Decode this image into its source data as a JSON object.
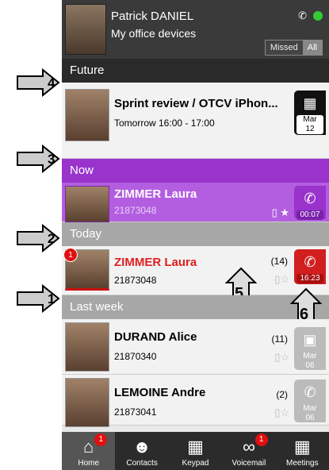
{
  "header": {
    "user_name": "Patrick DANIEL",
    "subtitle": "My office devices",
    "filter": {
      "missed": "Missed",
      "all": "All"
    }
  },
  "sections": {
    "future": "Future",
    "now": "Now",
    "today": "Today",
    "last_week": "Last week"
  },
  "future_item": {
    "title": "Sprint review / OTCV iPhon...",
    "time": "Tomorrow 16:00 - 17:00",
    "date_month": "Mar",
    "date_day": "12"
  },
  "now_item": {
    "name": "ZIMMER Laura",
    "number": "21873048",
    "duration": "00:07"
  },
  "today_item": {
    "name": "ZIMMER Laura",
    "number": "21873048",
    "count": "(14)",
    "time": "16:23",
    "badge": "1"
  },
  "week_items": [
    {
      "name": "DURAND Alice",
      "number": "21870340",
      "count": "(11)",
      "month": "Mar",
      "day": "06"
    },
    {
      "name": "LEMOINE Andre",
      "number": "21873041",
      "count": "(2)",
      "month": "Mar",
      "day": "06"
    }
  ],
  "nav": [
    {
      "label": "Home",
      "badge": "1",
      "icon": "home-icon"
    },
    {
      "label": "Contacts",
      "icon": "contacts-icon"
    },
    {
      "label": "Keypad",
      "icon": "keypad-icon"
    },
    {
      "label": "Voicemail",
      "badge": "1",
      "icon": "voicemail-icon"
    },
    {
      "label": "Meetings",
      "icon": "calendar-icon"
    }
  ],
  "annotations": [
    "1",
    "2",
    "3",
    "4",
    "5",
    "6"
  ]
}
